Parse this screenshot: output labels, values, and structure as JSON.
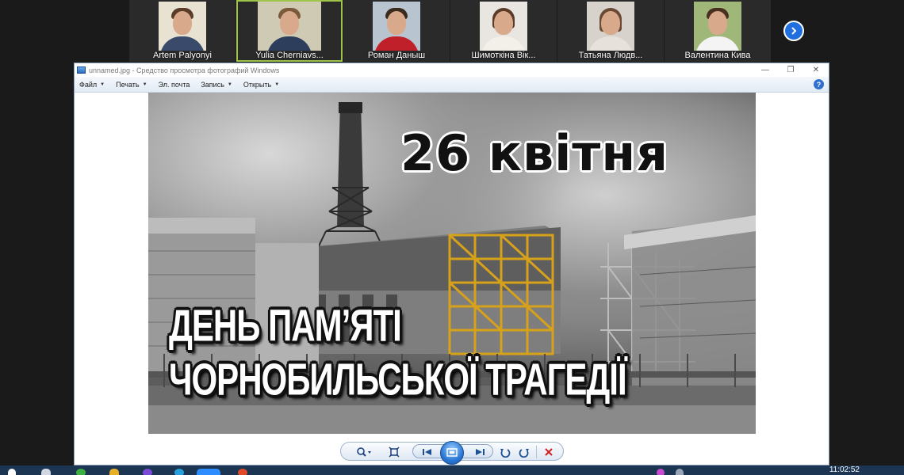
{
  "participants": [
    {
      "name": "Artem Palyonyi",
      "active": false
    },
    {
      "name": "Yulia Cherniavs...",
      "active": true
    },
    {
      "name": "Роман Даныш",
      "active": false
    },
    {
      "name": "Шимоткіна Вік...",
      "active": false
    },
    {
      "name": "Татьяна Людв...",
      "active": false
    },
    {
      "name": "Валентина Кива",
      "active": false
    }
  ],
  "viewer": {
    "title": "unnamed.jpg - Средство просмотра фотографий Windows",
    "menu": [
      {
        "label": "Файл",
        "has_dropdown": true
      },
      {
        "label": "Печать",
        "has_dropdown": true
      },
      {
        "label": "Эл. почта",
        "has_dropdown": false
      },
      {
        "label": "Запись",
        "has_dropdown": true
      },
      {
        "label": "Открыть",
        "has_dropdown": true
      }
    ],
    "help_label": "?",
    "window_controls": {
      "minimize": "—",
      "restore": "❐",
      "close": "✕"
    }
  },
  "image": {
    "date_text": "26 квітня",
    "caption_line1": "ДЕНЬ ПАМ’ЯТІ",
    "caption_line2": "ЧОРНОБИЛЬСЬКОЇ ТРАГЕДІЇ"
  },
  "taskbar": {
    "clock": "11:02:52"
  },
  "colors": {
    "accent_blue": "#1f6fe0",
    "active_speaker": "#9ec54a",
    "taskbar": "#1c3552"
  }
}
